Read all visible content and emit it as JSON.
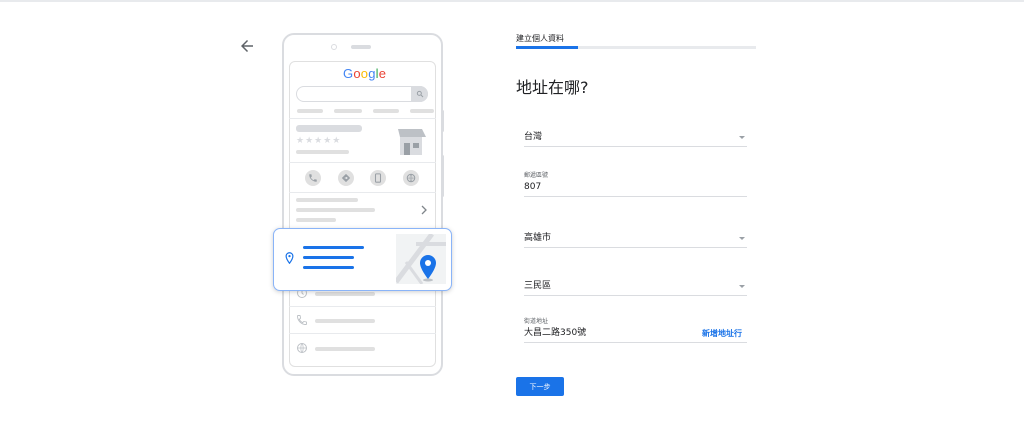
{
  "header": {
    "step_label": "建立個人資料",
    "progress_fraction": 0.26
  },
  "main": {
    "heading": "地址在哪?",
    "fields": {
      "country": {
        "value": "台灣"
      },
      "postal": {
        "label": "郵遞區號",
        "value": "807"
      },
      "city": {
        "value": "高雄市"
      },
      "district": {
        "value": "三民區"
      },
      "street": {
        "label": "街道地址",
        "value": "大昌二路350號",
        "add_line_label": "新增地址行"
      }
    },
    "next_button": "下一步"
  },
  "illustration": {
    "logo": {
      "letters": [
        "G",
        "o",
        "o",
        "g",
        "l",
        "e"
      ],
      "colors": [
        "#4285f4",
        "#ea4335",
        "#fbbc05",
        "#4285f4",
        "#34a853",
        "#ea4335"
      ]
    },
    "stars": "★★★★★"
  },
  "colors": {
    "accent": "#1a73e8",
    "divider": "#dadce0"
  },
  "icons": [
    "back-arrow-icon",
    "search-icon",
    "store-icon",
    "phone-icon",
    "directions-icon",
    "mobile-icon",
    "globe-icon",
    "chevron-right-icon",
    "location-pin-icon",
    "map-pin-icon",
    "clock-icon",
    "dropdown-arrow-icon"
  ]
}
